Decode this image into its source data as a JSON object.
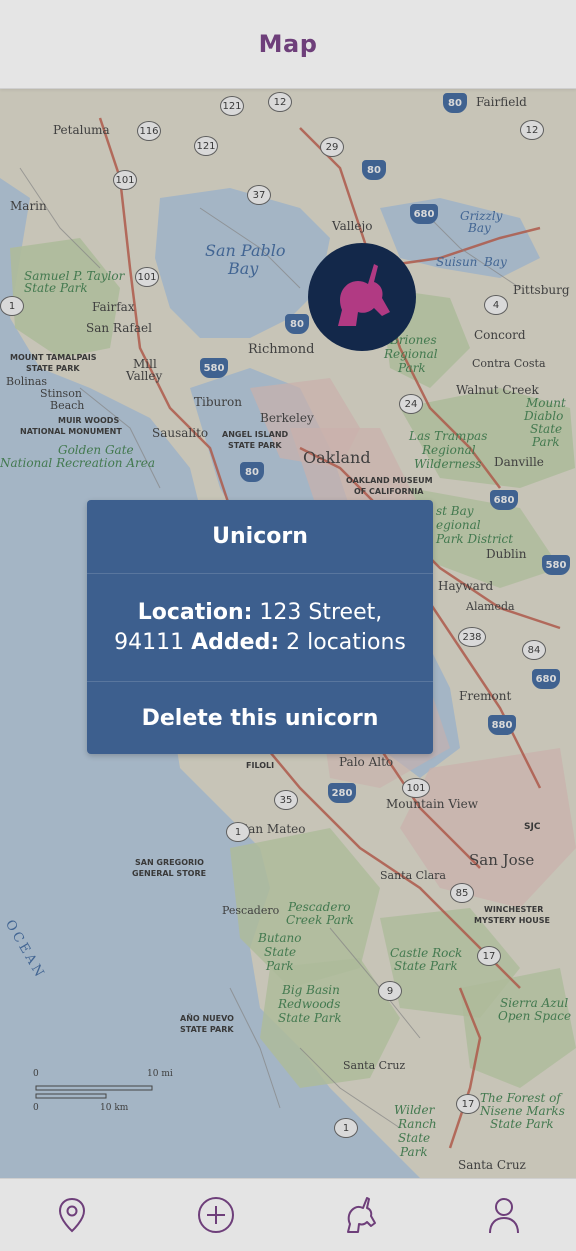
{
  "header": {
    "title": "Map"
  },
  "theme": {
    "header_text_color": "#6e3f7a",
    "marker_bg": "#13284a",
    "marker_icon_color": "#b13a83",
    "popup_bg": "#3d5f8e",
    "nav_icon_color": "#6e3f7a"
  },
  "map": {
    "labels": {
      "fairfield": "Fairfield",
      "petaluma": "Petaluma",
      "marin": "Marin",
      "vallejo": "Vallejo",
      "san_pablo_bay_1": "San Pablo",
      "san_pablo_bay_2": "Bay",
      "grizzly_bay_1": "Grizzly",
      "grizzly_bay_2": "Bay",
      "suisun_bay": "Suisun",
      "bay": "Bay",
      "samuel_taylor_1": "Samuel P. Taylor",
      "samuel_taylor_2": "State Park",
      "pittsburg": "Pittsburg",
      "fairfax": "Fairfax",
      "san_rafael": "San Rafael",
      "richmond": "Richmond",
      "concord": "Concord",
      "contra_costa": "Contra Costa",
      "briones_1": "Briones",
      "briones_2": "Regional",
      "briones_3": "Park",
      "mount_tamalpais_1": "MOUNT TAMALPAIS",
      "mount_tamalpais_2": "STATE PARK",
      "mill_valley_1": "Mill",
      "mill_valley_2": "Valley",
      "bolinas": "Bolinas",
      "stinson_1": "Stinson",
      "stinson_2": "Beach",
      "walnut_creek": "Walnut Creek",
      "tiburon": "Tiburon",
      "mount_diablo_1": "Mount",
      "mount_diablo_2": "Diablo",
      "mount_diablo_3": "State",
      "mount_diablo_4": "Park",
      "muir_woods_1": "MUIR WOODS",
      "muir_woods_2": "NATIONAL MONUMENT",
      "sausalito": "Sausalito",
      "berkeley": "Berkeley",
      "angel_island_1": "ANGEL ISLAND",
      "angel_island_2": "STATE PARK",
      "las_trampas_1": "Las Trampas",
      "las_trampas_2": "Regional",
      "las_trampas_3": "Wilderness",
      "danville": "Danville",
      "golden_gate_1": "Golden Gate",
      "golden_gate_2": "National Recreation Area",
      "oakland": "Oakland",
      "oakland_museum_1": "OAKLAND MUSEUM",
      "oakland_museum_2": "OF CALIFORNIA",
      "east_bay_1": "st Bay",
      "east_bay_2": "egional",
      "east_bay_3": "Park District",
      "dublin": "Dublin",
      "hayward": "Hayward",
      "alameda": "Alameda",
      "fremont": "Fremont",
      "filoli": "FILOLI",
      "palo_alto": "Palo Alto",
      "mountain_view": "Mountain View",
      "san_mateo": "San Mateo",
      "sjc": "SJC",
      "san_jose": "San Jose",
      "san_gregorio_1": "SAN GREGORIO",
      "san_gregorio_2": "GENERAL STORE",
      "santa_clara": "Santa Clara",
      "pescadero": "Pescadero",
      "pescadero_creek_1": "Pescadero",
      "pescadero_creek_2": "Creek Park",
      "winchester_1": "WINCHESTER",
      "winchester_2": "MYSTERY HOUSE",
      "butano_1": "Butano",
      "butano_2": "State",
      "butano_3": "Park",
      "castle_rock_1": "Castle Rock",
      "castle_rock_2": "State Park",
      "ocean": "OCEAN",
      "big_basin_1": "Big Basin",
      "big_basin_2": "Redwoods",
      "big_basin_3": "State Park",
      "sierra_azul_1": "Sierra Azul",
      "sierra_azul_2": "Open Space",
      "ano_nuevo_1": "AÑO NUEVO",
      "ano_nuevo_2": "STATE PARK",
      "santa_cruz_upper": "Santa Cruz",
      "forest_nisene_1": "The Forest of",
      "forest_nisene_2": "Nisene Marks",
      "forest_nisene_3": "State Park",
      "wilder_1": "Wilder",
      "wilder_2": "Ranch",
      "wilder_3": "State",
      "wilder_4": "Park",
      "santa_cruz": "Santa Cruz",
      "scale_0a": "0",
      "scale_10mi": "10 mi",
      "scale_0b": "0",
      "scale_10km": "10 km"
    },
    "shields": {
      "s121": "121",
      "s12a": "12",
      "s80a": "80",
      "s116": "116",
      "s121b": "121",
      "s29": "29",
      "s12b": "12",
      "s101a": "101",
      "s37": "37",
      "s80b": "80",
      "s680a": "680",
      "s101b": "101",
      "s1a": "1",
      "s4": "4",
      "s80c": "80",
      "s580a": "580",
      "s24": "24",
      "s80d": "80",
      "s680b": "680",
      "s580b": "580",
      "s238": "238",
      "s84": "84",
      "s680c": "680",
      "s880": "880",
      "s101c": "101",
      "s35": "35",
      "s280": "280",
      "s1b": "1",
      "s85": "85",
      "s17a": "17",
      "s9": "9",
      "s1c": "1",
      "s17b": "17"
    }
  },
  "marker": {
    "name": "Unicorn"
  },
  "popup": {
    "title": "Unicorn",
    "location_label": "Location:",
    "location_value": "123 Street, 94111",
    "added_label": "Added:",
    "added_value": "2 locations",
    "delete_label": "Delete this unicorn"
  },
  "nav": {
    "items": [
      {
        "icon": "map-pin-icon"
      },
      {
        "icon": "plus-circle-icon"
      },
      {
        "icon": "unicorn-icon"
      },
      {
        "icon": "user-icon"
      }
    ]
  }
}
